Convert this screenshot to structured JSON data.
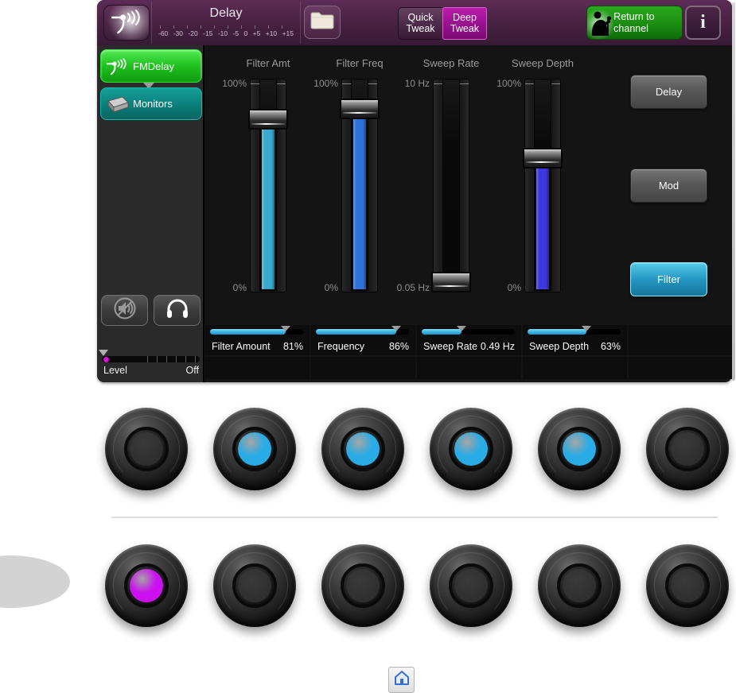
{
  "header": {
    "title": "Delay",
    "meter_ticks": [
      "-60",
      "-30",
      "-20",
      "-15",
      "-10",
      "-5",
      "0",
      "+5",
      "+10",
      "+15"
    ],
    "quick_tweak_label": "Quick Tweak",
    "deep_tweak_label": "Deep Tweak",
    "return_label": "Return to channel",
    "info_label": "i"
  },
  "sidebar": {
    "effect_button": "FMDelay",
    "monitors_button": "Monitors",
    "level_label": "Level",
    "level_value": "Off"
  },
  "faders": [
    {
      "label": "Filter Amt",
      "top_label": "100%",
      "bottom_label": "0%",
      "value_pct": 81,
      "fill_color": "#3aa9cf"
    },
    {
      "label": "Filter Freq",
      "top_label": "100%",
      "bottom_label": "0%",
      "value_pct": 86,
      "fill_color": "#2e72d9"
    },
    {
      "label": "Sweep Rate",
      "top_label": "10 Hz",
      "bottom_label": "0.05 Hz",
      "value_pct": 5,
      "fill_color": "#2e72d9"
    },
    {
      "label": "Sweep Depth",
      "top_label": "100%",
      "bottom_label": "0%",
      "value_pct": 63,
      "fill_color": "#3c38dd"
    }
  ],
  "section_buttons": [
    {
      "label": "Delay",
      "active": false
    },
    {
      "label": "Mod",
      "active": false
    },
    {
      "label": "Filter",
      "active": true
    }
  ],
  "params": [
    {
      "label": "Filter Amount",
      "value": "81%",
      "fill_pct": 81
    },
    {
      "label": "Frequency",
      "value": "86%",
      "fill_pct": 86
    },
    {
      "label": "Sweep Rate",
      "value": "0.49 Hz",
      "fill_pct": 43
    },
    {
      "label": "Sweep Depth",
      "value": "63%",
      "fill_pct": 63
    }
  ],
  "knobs": {
    "row1": [
      "off",
      "blue",
      "blue",
      "blue",
      "blue",
      "off"
    ],
    "row2": [
      "magenta",
      "off",
      "off",
      "off",
      "off",
      "off"
    ],
    "colors": {
      "blue": "#29ace6",
      "magenta": "#cd10f2",
      "off": "#2e2e2e"
    }
  },
  "icons": [
    "delay-echo-icon",
    "folder-icon",
    "singer-icon",
    "info-icon",
    "monitor-wedge-icon",
    "speaker-mute-icon",
    "headphones-icon",
    "home-icon"
  ]
}
